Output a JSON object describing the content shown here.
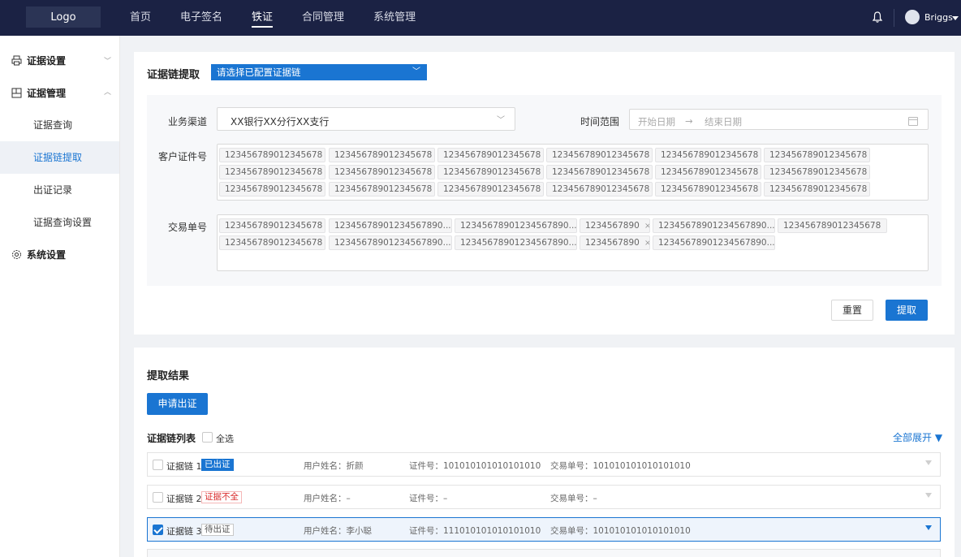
{
  "topbar": {
    "logo": "Logo",
    "nav": [
      "首页",
      "电子签名",
      "铁证",
      "合同管理",
      "系统管理"
    ],
    "active_nav": "铁证",
    "user": "Briggs"
  },
  "sidebar": {
    "group1": "证据设置",
    "group2": "证据管理",
    "items": [
      "证据查询",
      "证据链提取",
      "出证记录",
      "证据查询设置"
    ],
    "active_item": "证据链提取",
    "group3": "系统设置"
  },
  "extract": {
    "title": "证据链提取",
    "chain_select_placeholder": "请选择已配置证据链",
    "channel_label": "业务渠道",
    "channel_value": "XX银行XX分行XX支行",
    "time_label": "时间范围",
    "start_placeholder": "开始日期",
    "arrow": "→",
    "end_placeholder": "结束日期",
    "id_label": "客户证件号",
    "id_tags": [
      "123456789012345678",
      "123456789012345678",
      "123456789012345678",
      "123456789012345678",
      "123456789012345678",
      "123456789012345678",
      "123456789012345678",
      "123456789012345678",
      "123456789012345678",
      "123456789012345678",
      "123456789012345678",
      "123456789012345678",
      "123456789012345678",
      "123456789012345678",
      "123456789012345678",
      "123456789012345678",
      "123456789012345678",
      "123456789012345678"
    ],
    "order_label": "交易单号",
    "order_tags": [
      "123456789012345678",
      "12345678901234567890...",
      "12345678901234567890...",
      "1234567890",
      "12345678901234567890...",
      "123456789012345678",
      "123456789012345678",
      "12345678901234567890...",
      "12345678901234567890...",
      "1234567890",
      "12345678901234567890..."
    ],
    "reset": "重置",
    "submit": "提取"
  },
  "results": {
    "title": "提取结果",
    "apply_button": "申请出证",
    "list_label": "证据链列表",
    "select_all": "全选",
    "expand_all": "全部展开 ▼",
    "rows": [
      {
        "name": "证据链 1",
        "status": "已出证",
        "user": "用户姓名：折颜",
        "cert": "证件号：101010101010101010",
        "order": "交易单号：101010101010101010",
        "checked": false
      },
      {
        "name": "证据链 2",
        "status": "证据不全",
        "user": "用户姓名：–",
        "cert": "证件号：–",
        "order": "交易单号：–",
        "checked": false
      },
      {
        "name": "证据链 3",
        "status": "待出证",
        "user": "用户姓名：李小聪",
        "cert": "证件号：111010101010101010",
        "order": "交易单号：101010101010101010",
        "checked": true
      }
    ]
  },
  "colors": {
    "primary": "#1a75d2",
    "topbar": "#1b2244",
    "danger": "#d92b2b"
  }
}
